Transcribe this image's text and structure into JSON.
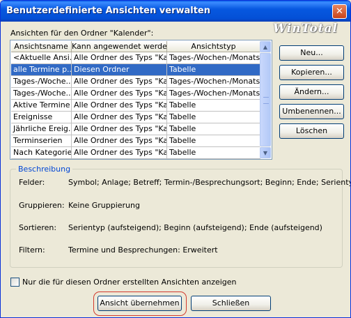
{
  "window": {
    "title": "Benutzerdefinierte Ansichten verwalten",
    "close_label": "✕",
    "watermark": "WinTotal"
  },
  "list_label": "Ansichten für den Ordner \"Kalender\":",
  "columns": [
    "Ansichtsname",
    "Kann angewendet werde...",
    "Ansichtstyp"
  ],
  "rows": [
    [
      "<Aktuelle Ansi...",
      "Alle Ordner des Typs \"Ka...",
      "Tages-/Wochen-/Monats..."
    ],
    [
      "alle Termine p...",
      "Diesen Ordner",
      "Tabelle"
    ],
    [
      "Tages-/Woche...",
      "Alle Ordner des Typs \"Ka...",
      "Tages-/Wochen-/Monats..."
    ],
    [
      "Tages-/Woche...",
      "Alle Ordner des Typs \"Ka...",
      "Tages-/Wochen-/Monats..."
    ],
    [
      "Aktive Termine",
      "Alle Ordner des Typs \"Ka...",
      "Tabelle"
    ],
    [
      "Ereignisse",
      "Alle Ordner des Typs \"Ka...",
      "Tabelle"
    ],
    [
      "Jährliche Ereig...",
      "Alle Ordner des Typs \"Ka...",
      "Tabelle"
    ],
    [
      "Terminserien",
      "Alle Ordner des Typs \"Ka...",
      "Tabelle"
    ],
    [
      "Nach Kategorie",
      "Alle Ordner des Typs \"Ka...",
      "Tabelle"
    ]
  ],
  "selected_row": 1,
  "scroll": {
    "up": "▲",
    "down": "▼"
  },
  "buttons": {
    "new": "Neu...",
    "copy": "Kopieren...",
    "modify": "Ändern...",
    "rename": "Umbenennen...",
    "delete": "Löschen",
    "apply": "Ansicht übernehmen",
    "close": "Schließen"
  },
  "description": {
    "title": "Beschreibung",
    "fields_label": "Felder:",
    "fields_value": "Symbol; Anlage; Betreff; Termin-/Besprechungsort; Beginn; Ende; Serientyp; Ka",
    "grouping_label": "Gruppieren:",
    "grouping_value": "Keine Gruppierung",
    "sorting_label": "Sortieren:",
    "sorting_value": "Serientyp (aufsteigend); Beginn (aufsteigend); Ende (aufsteigend)",
    "filter_label": "Filtern:",
    "filter_value": "Termine und Besprechungen: Erweitert"
  },
  "checkbox": {
    "label": "Nur die für diesen Ordner erstellten Ansichten anzeigen",
    "checked": false
  },
  "colors": {
    "titlebar": "#0758e0",
    "selection": "#316ac5",
    "highlight_ring": "#d23a2e",
    "groupbox_title": "#0046d5"
  }
}
